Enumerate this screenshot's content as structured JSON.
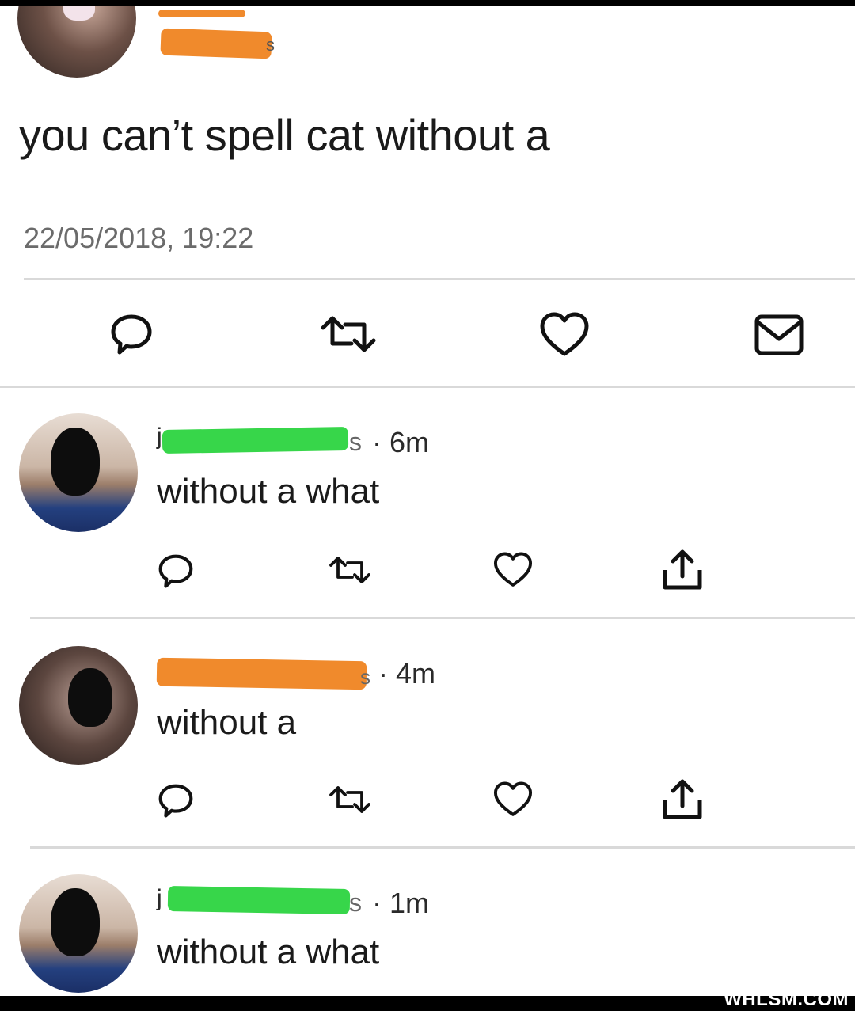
{
  "main_tweet": {
    "text": "you can’t spell cat without a",
    "timestamp": "22/05/2018, 19:22",
    "handle_tail": "s"
  },
  "main_actions": [
    {
      "icon": "reply-icon"
    },
    {
      "icon": "retweet-icon"
    },
    {
      "icon": "like-icon"
    },
    {
      "icon": "message-icon"
    }
  ],
  "replies": [
    {
      "handle_lead": "j",
      "handle_tail": "s",
      "time": "· 6m",
      "text": "without a what",
      "redaction_color": "#37d64a"
    },
    {
      "handle_lead": "",
      "handle_tail": "s",
      "time": "· 4m",
      "text": "without a",
      "redaction_color": "#f08a2c"
    },
    {
      "handle_lead": "j",
      "handle_tail": "s",
      "time": "· 1m",
      "text": "without a what",
      "redaction_color": "#37d64a"
    }
  ],
  "reply_actions": [
    {
      "icon": "reply-icon"
    },
    {
      "icon": "retweet-icon"
    },
    {
      "icon": "like-icon"
    },
    {
      "icon": "share-icon"
    }
  ],
  "watermark": "WHLSM.COM"
}
